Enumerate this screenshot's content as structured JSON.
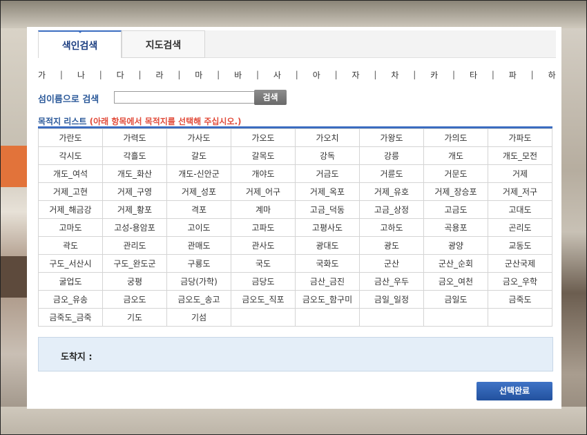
{
  "tabs": {
    "index": "색인검색",
    "map": "지도검색"
  },
  "index_letters": [
    "가",
    "나",
    "다",
    "라",
    "마",
    "바",
    "사",
    "아",
    "자",
    "차",
    "카",
    "타",
    "파",
    "하"
  ],
  "search": {
    "label": "섬이름으로 검색",
    "value": "",
    "placeholder": "",
    "button": "검색"
  },
  "list": {
    "title": "목적지 리스트",
    "hint": "(아래 항목에서 목적지를 선택해 주십시오.)",
    "rows": [
      [
        "가란도",
        "가력도",
        "가사도",
        "가오도",
        "가오치",
        "가왕도",
        "가의도",
        "가파도"
      ],
      [
        "각시도",
        "각흘도",
        "갈도",
        "갈목도",
        "강독",
        "강릉",
        "개도",
        "개도_모전"
      ],
      [
        "개도_여석",
        "개도_화산",
        "개도-신안군",
        "개야도",
        "거금도",
        "거륜도",
        "거문도",
        "거제"
      ],
      [
        "거제_고현",
        "거제_구영",
        "거제_성포",
        "거제_어구",
        "거제_옥포",
        "거제_유호",
        "거제_장승포",
        "거제_저구"
      ],
      [
        "거제_해금강",
        "거제_황포",
        "격포",
        "계마",
        "고금_덕동",
        "고금_상정",
        "고금도",
        "고대도"
      ],
      [
        "고마도",
        "고성-용암포",
        "고이도",
        "고파도",
        "고평사도",
        "고하도",
        "곡용포",
        "곤리도"
      ],
      [
        "곽도",
        "관리도",
        "관매도",
        "관사도",
        "광대도",
        "광도",
        "광양",
        "교동도"
      ],
      [
        "구도_서산시",
        "구도_완도군",
        "구룡도",
        "국도",
        "국화도",
        "군산",
        "군산_순회",
        "군산국제"
      ],
      [
        "굴업도",
        "궁평",
        "금당(가학)",
        "금당도",
        "금산_금진",
        "금산_우두",
        "금오_여천",
        "금오_우학"
      ],
      [
        "금오_유송",
        "금오도",
        "금오도_송고",
        "금오도_직포",
        "금오도_함구미",
        "금일_일정",
        "금일도",
        "금죽도"
      ],
      [
        "금죽도_금죽",
        "기도",
        "기섬",
        "",
        "",
        "",
        "",
        ""
      ]
    ]
  },
  "arrival": {
    "label": "도착지 :",
    "value": ""
  },
  "submit_label": "선택완료"
}
